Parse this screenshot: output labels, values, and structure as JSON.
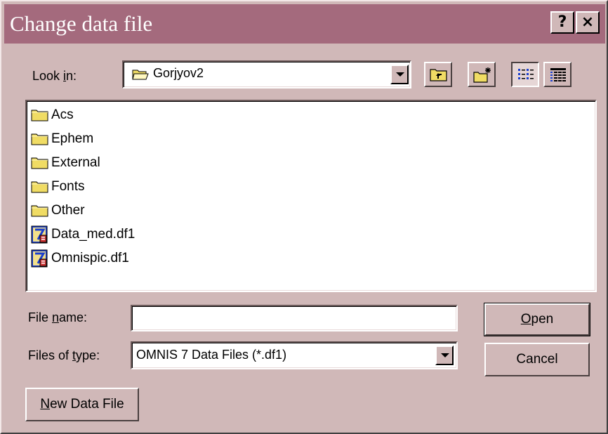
{
  "dialog": {
    "title": "Change data file",
    "help_button": "?",
    "close_button": "×"
  },
  "look_in": {
    "label_prefix": "Look ",
    "label_accel": "i",
    "label_suffix": "n:",
    "value": "Gorjyov2"
  },
  "toolbar": {
    "icons": [
      "up-one-level-icon",
      "create-new-folder-icon",
      "list-view-icon",
      "details-view-icon"
    ]
  },
  "files": [
    {
      "name": "Acs",
      "type": "folder"
    },
    {
      "name": "Ephem",
      "type": "folder"
    },
    {
      "name": "External",
      "type": "folder"
    },
    {
      "name": "Fonts",
      "type": "folder"
    },
    {
      "name": "Other",
      "type": "folder"
    },
    {
      "name": "Data_med.df1",
      "type": "datafile"
    },
    {
      "name": "Omnispic.df1",
      "type": "datafile"
    }
  ],
  "file_name": {
    "label_prefix": "File ",
    "label_accel": "n",
    "label_suffix": "ame:",
    "value": ""
  },
  "file_type": {
    "label_prefix": "Files of ",
    "label_accel": "t",
    "label_suffix": "ype:",
    "value": "OMNIS 7 Data Files (*.df1)"
  },
  "buttons": {
    "open_accel": "O",
    "open_rest": "pen",
    "cancel": "Cancel",
    "new_accel": "N",
    "new_rest": "ew Data File"
  },
  "colors": {
    "title_bar": "#a46a7d",
    "dialog_face": "#d0b8b8",
    "folder": "#f0dc64",
    "datafile_accent": "#1a3fcf"
  }
}
